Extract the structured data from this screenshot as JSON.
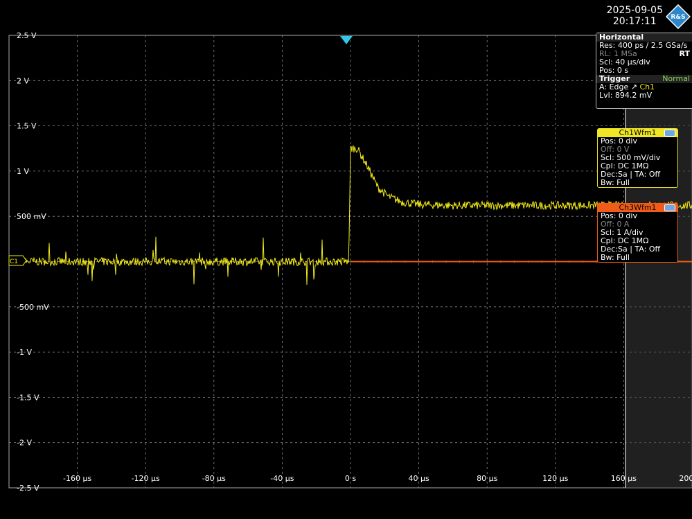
{
  "clock": {
    "date": "2025-09-05",
    "time": "20:17:11"
  },
  "logo_text": "R&S",
  "horizontal": {
    "title": "Horizontal",
    "res": "Res: 400 ps / 2.5 GSa/s",
    "rl": "RL:  1 MSa",
    "rt": "RT",
    "scl": "Scl:  40 µs/div",
    "pos": "Pos:  0 s"
  },
  "trigger": {
    "title": "Trigger",
    "mode": "Normal",
    "source_prefix": "A:    Edge",
    "source": "Ch1",
    "level": "Lvl:   894.2 mV"
  },
  "ch1": {
    "title": "Ch1Wfm1",
    "pos": "Pos: 0 div",
    "off": "Off:  0 V",
    "scl": "Scl:  500 mV/div",
    "cpl": "Cpl: DC 1MΩ",
    "dec": "Dec:Sa | TA: Off",
    "bw": "Bw: Full",
    "marker": "C1"
  },
  "ch3": {
    "title": "Ch3Wfm1",
    "pos": "Pos: 0 div",
    "off": "Off:  0 A",
    "scl": "Scl:  1 A/div",
    "cpl": "Cpl: DC 1MΩ",
    "dec": "Dec:Sa | TA: Off",
    "bw": "Bw: Full"
  },
  "colors": {
    "ch1": "#f5ec1a",
    "ch3": "#f05b1a",
    "trigger": "#35c7e8",
    "grid": "#8a8a8a"
  },
  "chart_data": {
    "type": "line",
    "x_ticks": [
      "-160 µs",
      "-120 µs",
      "-80 µs",
      "-40 µs",
      "0 s",
      "40 µs",
      "80 µs",
      "120 µs",
      "160 µs",
      "200 µs"
    ],
    "y_ticks": [
      "2.5 V",
      "2 V",
      "1.5 V",
      "1 V",
      "500 mV",
      "",
      "-500 mV",
      "-1 V",
      "-1.5 V",
      "-2 V",
      "-2.5 V"
    ],
    "xlim": [
      -200,
      200
    ],
    "ylim": [
      -2.5,
      2.5
    ],
    "grid": true,
    "series": [
      {
        "name": "Ch1Wfm1",
        "x": [
          -200,
          -1,
          0,
          4,
          10,
          16,
          22,
          30,
          40,
          60,
          100,
          200
        ],
        "values": [
          0,
          0,
          1.25,
          1.25,
          1.05,
          0.82,
          0.72,
          0.66,
          0.63,
          0.62,
          0.62,
          0.62
        ]
      },
      {
        "name": "Ch3Wfm1",
        "x": [
          0,
          200
        ],
        "values": [
          0,
          0
        ]
      }
    ]
  }
}
